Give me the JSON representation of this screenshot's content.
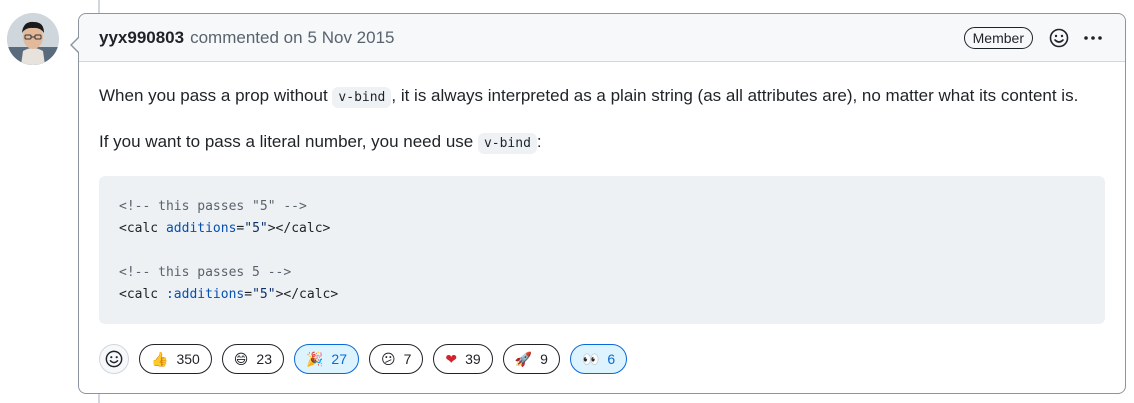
{
  "comment": {
    "author": "yyx990803",
    "action": "commented on",
    "date": "5 Nov 2015",
    "role_badge": "Member",
    "paragraph1_before": "When you pass a prop without ",
    "paragraph1_code": "v-bind",
    "paragraph1_after": ", it is always interpreted as a plain string (as all attributes are), no matter what its content is.",
    "paragraph2_before": "If you want to pass a literal number, you need use ",
    "paragraph2_code": "v-bind",
    "paragraph2_after": ":",
    "code_block": {
      "line1": "<!-- this passes \"5\" -->",
      "line2_tag_open": "<calc ",
      "line2_attr": "additions",
      "line2_eq": "=",
      "line2_value": "\"5\"",
      "line2_close": "></calc>",
      "line4": "<!-- this passes 5 -->",
      "line5_tag_open": "<calc ",
      "line5_attr": ":additions",
      "line5_eq": "=",
      "line5_value": "\"5\"",
      "line5_close": "></calc>"
    }
  },
  "reactions": [
    {
      "icon": "thumbs-up",
      "emoji": "👍",
      "count": "350",
      "active": false
    },
    {
      "icon": "laugh",
      "emoji": "😄",
      "count": "23",
      "active": false
    },
    {
      "icon": "hooray",
      "emoji": "🎉",
      "count": "27",
      "active": true
    },
    {
      "icon": "confused",
      "emoji": "😕",
      "count": "7",
      "active": false
    },
    {
      "icon": "heart",
      "emoji": "❤",
      "count": "39",
      "active": false
    },
    {
      "icon": "rocket",
      "emoji": "🚀",
      "count": "9",
      "active": false
    },
    {
      "icon": "eyes",
      "emoji": "👀",
      "count": "6",
      "active": true
    }
  ],
  "colors": {
    "accent": "#0969da",
    "header_bg": "#f6f8fa",
    "code_bg": "#eef1f4"
  }
}
